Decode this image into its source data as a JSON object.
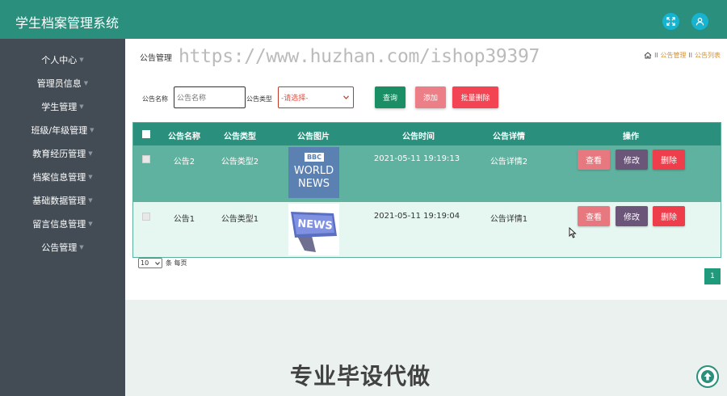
{
  "app": {
    "title": "学生档案管理系统"
  },
  "header": {
    "buttons": [
      {
        "icon": "fullscreen-icon"
      },
      {
        "icon": "user-icon"
      }
    ]
  },
  "sidebar": {
    "items": [
      {
        "label": "个人中心"
      },
      {
        "label": "管理员信息"
      },
      {
        "label": "学生管理"
      },
      {
        "label": "班级/年级管理"
      },
      {
        "label": "教育经历管理"
      },
      {
        "label": "档案信息管理"
      },
      {
        "label": "基础数据管理"
      },
      {
        "label": "留言信息管理"
      },
      {
        "label": "公告管理"
      }
    ]
  },
  "page": {
    "heading": "公告管理",
    "watermark": "https://www.huzhan.com/ishop39397"
  },
  "breadcrumb": {
    "home_icon": "home-icon",
    "sep": "ll",
    "items": [
      "公告管理",
      "公告列表"
    ]
  },
  "search": {
    "name_label": "公告名称",
    "name_placeholder": "公告名称",
    "type_label": "公告类型",
    "type_selected": "-请选择-",
    "query_button": "查询",
    "add_button": "添加",
    "batch_delete_button": "批量删除"
  },
  "table": {
    "headers": [
      "公告名称",
      "公告类型",
      "公告图片",
      "公告时间",
      "公告详情",
      "操作"
    ],
    "rows": [
      {
        "name": "公告2",
        "type": "公告类型2",
        "image_text": [
          "BBC",
          "WORLD",
          "NEWS"
        ],
        "time": "2021-05-11 19:19:13",
        "detail": "公告详情2"
      },
      {
        "name": "公告1",
        "type": "公告类型1",
        "image_text": [
          "NEWS"
        ],
        "time": "2021-05-11 19:19:04",
        "detail": "公告详情1"
      }
    ],
    "actions": {
      "view": "查看",
      "edit": "修改",
      "delete": "删除"
    }
  },
  "pagination": {
    "per_page": "10",
    "per_page_suffix": "条 每页",
    "current_page": "1"
  },
  "promo": {
    "text": "专业毕设代做"
  },
  "colors": {
    "primary": "#2a8f7c",
    "sidebar": "#434c55",
    "danger": "#ee3d4b",
    "accent": "#18b4cf"
  }
}
